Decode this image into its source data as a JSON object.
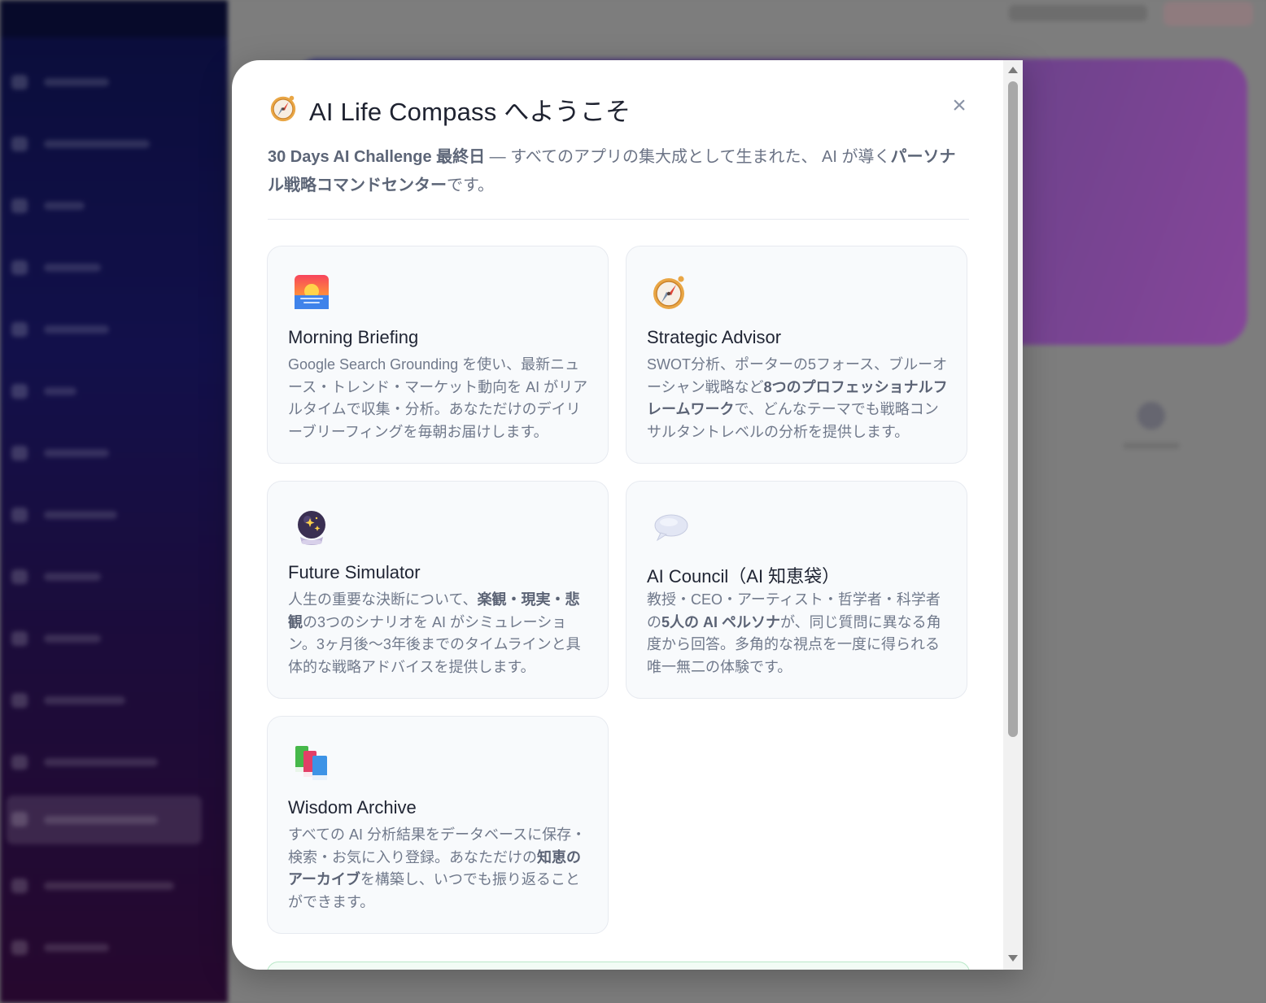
{
  "modal": {
    "title": "AI Life Compass へようこそ",
    "title_icon": "compass-icon",
    "close_label": "×",
    "intro": {
      "part1_bold": "30 Days AI Challenge 最終日",
      "part2": " — すべてのアプリの集大成として生まれた、 AI が導く",
      "part3_bold": "パーソナル戦略コマンドセンター",
      "part4": "です。"
    }
  },
  "features": [
    {
      "icon": "sunrise-icon",
      "title": "Morning Briefing",
      "desc": [
        {
          "text": "Google Search Grounding を使い、最新ニュース・トレンド・マーケット動向を AI がリアルタイムで収集・分析。あなただけのデイリーブリーフィングを毎朝お届けします。"
        }
      ]
    },
    {
      "icon": "compass-icon",
      "title": "Strategic Advisor",
      "desc": [
        {
          "text": "SWOT分析、ポーターの5フォース、ブルーオーシャン戦略など"
        },
        {
          "text": "8つのプロフェッショナルフレームワーク",
          "bold": true
        },
        {
          "text": "で、どんなテーマでも戦略コンサルタントレベルの分析を提供します。"
        }
      ]
    },
    {
      "icon": "crystal-ball-icon",
      "title": "Future Simulator",
      "desc": [
        {
          "text": "人生の重要な決断について、"
        },
        {
          "text": "楽観・現実・悲観",
          "bold": true
        },
        {
          "text": "の3つのシナリオを AI がシミュレーション。3ヶ月後〜3年後までのタイムラインと具体的な戦略アドバイスを提供します。"
        }
      ]
    },
    {
      "icon": "speech-bubble-icon",
      "title": "AI Council（AI 知恵袋）",
      "desc": [
        {
          "text": "教授・CEO・アーティスト・哲学者・科学者の"
        },
        {
          "text": "5人の AI ペルソナ",
          "bold": true
        },
        {
          "text": "が、同じ質問に異なる角度から回答。多角的な視点を一度に得られる唯一無二の体験です。"
        }
      ]
    },
    {
      "icon": "books-icon",
      "title": "Wisdom Archive",
      "desc": [
        {
          "text": "すべての AI 分析結果をデータベースに保存・検索・お気に入り登録。あなただけの"
        },
        {
          "text": "知恵のアーカイブ",
          "bold": true
        },
        {
          "text": "を構築し、いつでも振り返ることができます。"
        }
      ]
    }
  ]
}
